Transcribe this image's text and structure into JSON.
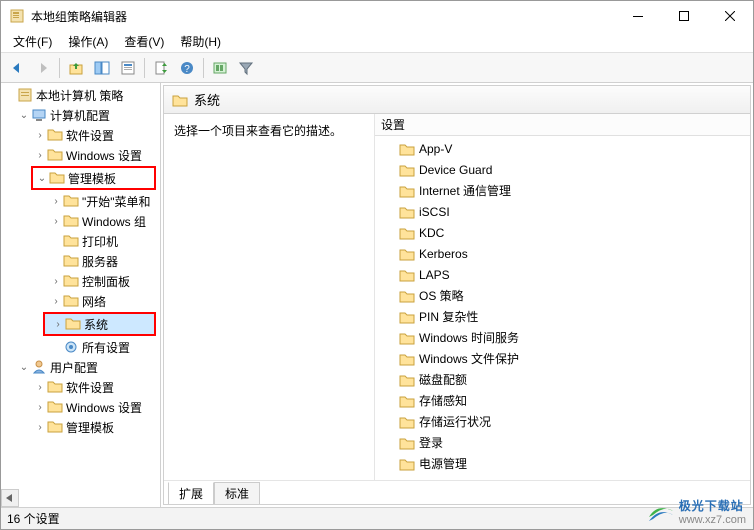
{
  "window": {
    "title": "本地组策略编辑器"
  },
  "menu": {
    "file": "文件(F)",
    "action": "操作(A)",
    "view": "查看(V)",
    "help": "帮助(H)"
  },
  "tree": {
    "root": "本地计算机 策略",
    "computer": "计算机配置",
    "c_soft": "软件设置",
    "c_win": "Windows 设置",
    "c_admin": "管理模板",
    "c_start": "\"开始\"菜单和",
    "c_wincomp": "Windows 组",
    "c_printer": "打印机",
    "c_server": "服务器",
    "c_cpanel": "控制面板",
    "c_network": "网络",
    "c_system": "系统",
    "c_all": "所有设置",
    "user": "用户配置",
    "u_soft": "软件设置",
    "u_win": "Windows 设置",
    "u_admin": "管理模板"
  },
  "right": {
    "header": "系统",
    "desc": "选择一个项目来查看它的描述。",
    "col_setting": "设置",
    "items": [
      "App-V",
      "Device Guard",
      "Internet 通信管理",
      "iSCSI",
      "KDC",
      "Kerberos",
      "LAPS",
      "OS 策略",
      "PIN 复杂性",
      "Windows 时间服务",
      "Windows 文件保护",
      "磁盘配额",
      "存储感知",
      "存储运行状况",
      "登录",
      "电源管理"
    ],
    "tab_ext": "扩展",
    "tab_std": "标准"
  },
  "status": "16 个设置",
  "watermark": {
    "brand": "极光下载站",
    "url": "www.xz7.com"
  }
}
